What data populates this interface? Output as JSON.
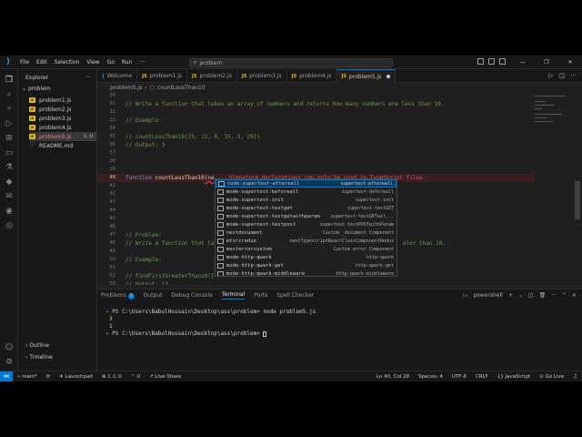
{
  "app": {
    "menu": [
      "File",
      "Edit",
      "Selection",
      "View",
      "Go",
      "Run"
    ],
    "more": "···",
    "command_center": "problem"
  },
  "sidebar": {
    "title": "Explorer",
    "folder": "problem",
    "files": [
      {
        "name": "problem1.js",
        "type": "js"
      },
      {
        "name": "problem2.js",
        "type": "js"
      },
      {
        "name": "problem3.js",
        "type": "js"
      },
      {
        "name": "problem4.js",
        "type": "js"
      },
      {
        "name": "problem5.js",
        "type": "js",
        "status": "1, U",
        "active": true
      },
      {
        "name": "README.md",
        "type": "md"
      }
    ],
    "outline": "Outline",
    "timeline": "Timeline"
  },
  "tabs": [
    {
      "label": "Welcome",
      "icon": "vscode-icon"
    },
    {
      "label": "problem1.js",
      "icon": "js"
    },
    {
      "label": "problem2.js",
      "icon": "js"
    },
    {
      "label": "problem3.js",
      "icon": "js"
    },
    {
      "label": "problem4.js",
      "icon": "js"
    },
    {
      "label": "problem5.js",
      "icon": "js",
      "active": true
    }
  ],
  "breadcrumb": {
    "file": "problem5.js",
    "symbol": "countLessThan10"
  },
  "editor": {
    "lines": [
      {
        "n": "30",
        "text": ""
      },
      {
        "n": "31",
        "text": "// Write a function that takes an array of numbers and returns how many numbers are less than 10."
      },
      {
        "n": "32",
        "text": ""
      },
      {
        "n": "33",
        "text": "// Example:"
      },
      {
        "n": "34",
        "text": ""
      },
      {
        "n": "35",
        "text": "// countLessThan10([5, 12, 8, 15, 3, 20])"
      },
      {
        "n": "36",
        "text": "// Output: 3"
      },
      {
        "n": "37",
        "text": ""
      },
      {
        "n": "38",
        "text": ""
      },
      {
        "n": "39",
        "text": ""
      },
      {
        "n": "40",
        "kw": "function",
        "fn": "countLessThan10",
        "rest": "(ne",
        "error": "Signature declarations can only be used in TypeScript files."
      },
      {
        "n": "41",
        "text": ""
      },
      {
        "n": "42",
        "text": ""
      },
      {
        "n": "43",
        "text": ""
      },
      {
        "n": "44",
        "text": ""
      },
      {
        "n": "45",
        "text": ""
      },
      {
        "n": "46",
        "text": ""
      },
      {
        "n": "47",
        "text": "// Problem:"
      },
      {
        "n": "48",
        "text": "// Write a function that ta",
        "tail": "ater than 10."
      },
      {
        "n": "49",
        "text": ""
      },
      {
        "n": "50",
        "text": "// Example:"
      },
      {
        "n": "51",
        "text": ""
      },
      {
        "n": "52",
        "text": "// findFirstGreaterThan10(["
      },
      {
        "n": "53",
        "text": "// Output: 12"
      }
    ],
    "suggestions": [
      {
        "match": "ne",
        "label": "code-supertest-aftereall",
        "detail": "supertest-aftereall",
        "selected": true
      },
      {
        "label": "mode-supertest-beforeall",
        "detail": "supertest-beforeall"
      },
      {
        "label": "mode-supertest-init",
        "detail": "supertest-init"
      },
      {
        "label": "mode-supertest-testget",
        "detail": "supertest-testGET"
      },
      {
        "label": "mode-supertest-testgetwithparam",
        "detail": "supertest-testGETwit..."
      },
      {
        "label": "mode-supertest-testpost",
        "detail": "supertest-testPOSTwithParam"
      },
      {
        "label": "nextdocument",
        "detail": "Custom _document Component"
      },
      {
        "label": "mtsrcredux",
        "detail": "nextTypescriptReactClassComponentRedux"
      },
      {
        "label": "mexterrorcustom",
        "detail": "Custom error Component"
      },
      {
        "label": "mode-http-qwark",
        "detail": "http-qwark"
      },
      {
        "label": "mode-http-qwark-get",
        "detail": "http-qwark-get"
      },
      {
        "label": "mode-http-qwark-middleware",
        "detail": "http-qwark-middleware"
      }
    ]
  },
  "panel": {
    "tabs": [
      "Problems",
      "Output",
      "Debug Console",
      "Terminal",
      "Ports",
      "Spell Checker"
    ],
    "problems_count": "1",
    "shell": "powershell",
    "terminal": [
      "PS C:\\Users\\BabulHossain\\Desktop\\ass\\problem> node problem5.js",
      "3",
      "1",
      "PS C:\\Users\\BabulHossain\\Desktop\\ass\\problem> "
    ]
  },
  "status": {
    "branch": "main*",
    "launchpad": "Launchpad",
    "errors": "1",
    "warnings": "0",
    "ports": "0",
    "live_share": "Live Share",
    "position": "Ln 40, Col 28",
    "spaces": "Spaces: 4",
    "encoding": "UTF-8",
    "eol": "CRLF",
    "language": "JavaScript",
    "go_live": "Go Live"
  },
  "colors": {
    "accent": "#0078d4",
    "error": "#f14c4c",
    "js": "#e5c00d",
    "modified": "#e2c08d"
  }
}
